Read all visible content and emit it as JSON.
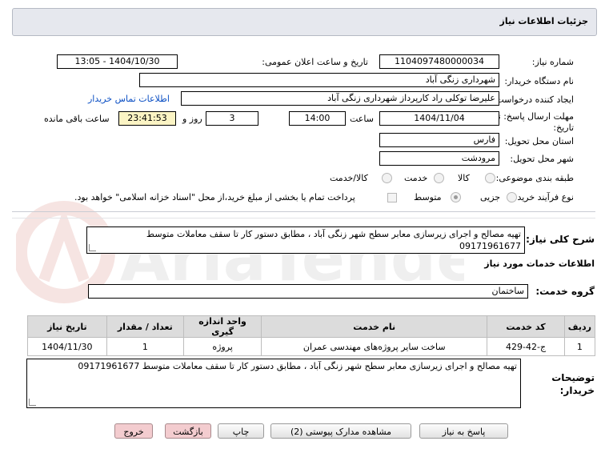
{
  "header": {
    "title": "جزئیات اطلاعات نیاز"
  },
  "fields": {
    "need_number_label": "شماره نیاز:",
    "need_number": "1104097480000034",
    "announce_label": "تاریخ و ساعت اعلان عمومی:",
    "announce_value": "1404/10/30 - 13:05",
    "buyer_org_label": "نام دستگاه خریدار:",
    "buyer_org": "شهرداری زنگی آباد",
    "creator_label": "ایجاد کننده درخواست:",
    "creator": "علیرضا توکلی راد کارپرداز شهرداری زنگی آباد",
    "contact_link": "اطلاعات تماس خریدار",
    "deadline_label_1": "مهلت ارسال پاسخ: تا",
    "deadline_label_2": "تاریخ:",
    "deadline_date": "1404/11/04",
    "time_label": "ساعت",
    "deadline_time": "14:00",
    "days_value": "3",
    "days_label": "روز و",
    "remaining_time": "23:41:53",
    "remaining_label": "ساعت باقی مانده",
    "province_label": "استان محل تحویل:",
    "province": "فارس",
    "city_label": "شهر محل تحویل:",
    "city": "مرودشت",
    "category_label": "طبقه بندی موضوعی:",
    "category_options": [
      "کالا",
      "خدمت",
      "کالا/خدمت"
    ],
    "process_label": "نوع فرآیند خرید :",
    "process_options": [
      "جزیی",
      "متوسط"
    ],
    "payment_note": "پرداخت تمام یا بخشی از مبلغ خرید،از محل \"اسناد خزانه اسلامی\" خواهد بود."
  },
  "summary": {
    "label": "شرح کلی نیاز:",
    "text": "تهیه مصالح و اجرای زیرسازی معابر سطح شهر زنگی آباد ، مطابق دستور کار تا سقف معاملات متوسط 09171961677"
  },
  "services": {
    "section_title": "اطلاعات خدمات مورد نیاز",
    "group_label": "گروه خدمت:",
    "group_value": "ساختمان",
    "columns": [
      "ردیف",
      "کد خدمت",
      "نام خدمت",
      "واحد اندازه گیری",
      "تعداد / مقدار",
      "تاریخ نیاز"
    ],
    "rows": [
      [
        "1",
        "ج-42-429",
        "ساخت سایر پروژه‌های مهندسی عمران",
        "پروژه",
        "1",
        "1404/11/30"
      ]
    ]
  },
  "buyer_notes": {
    "label_1": "توضیحات",
    "label_2": "خریدار:",
    "text": "تهیه مصالح و اجرای زیرسازی معابر سطح شهر زنگی آباد ، مطابق دستور کار تا سقف معاملات متوسط 09171961677"
  },
  "buttons": {
    "reply": "پاسخ به نیاز",
    "attachments": "مشاهده مدارک پیوستی (2)",
    "print": "چاپ",
    "back": "بازگشت",
    "exit": "خروج"
  },
  "colors": {
    "pink_button": "#f3cccf",
    "yellow_field": "#fbf4c4",
    "link": "#0b4fc4",
    "titlebar": "#e6e8ee"
  }
}
